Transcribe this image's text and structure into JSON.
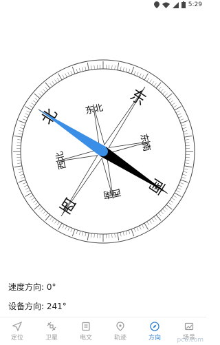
{
  "status_bar": {
    "time": "5:29"
  },
  "compass": {
    "heading_deg": 241,
    "directions": {
      "north": "北",
      "south": "南",
      "east": "东",
      "west": "西",
      "northeast": "东北",
      "northwest": "西北",
      "southeast": "东南",
      "southwest": "西南"
    },
    "colors": {
      "north_needle": "#3a8ee6",
      "south_needle": "#000000"
    }
  },
  "info": {
    "speed_direction": "速度方向: 0°",
    "device_direction": "设备方向: 241°"
  },
  "tabs": [
    {
      "label": "定位",
      "icon": "location-arrow-icon",
      "active": false
    },
    {
      "label": "卫星",
      "icon": "satellite-icon",
      "active": false
    },
    {
      "label": "电文",
      "icon": "document-icon",
      "active": false
    },
    {
      "label": "轨迹",
      "icon": "map-pin-icon",
      "active": false
    },
    {
      "label": "方向",
      "icon": "compass-icon",
      "active": true
    },
    {
      "label": "场景",
      "icon": "scene-icon",
      "active": false
    }
  ],
  "watermark": "pc6.com"
}
